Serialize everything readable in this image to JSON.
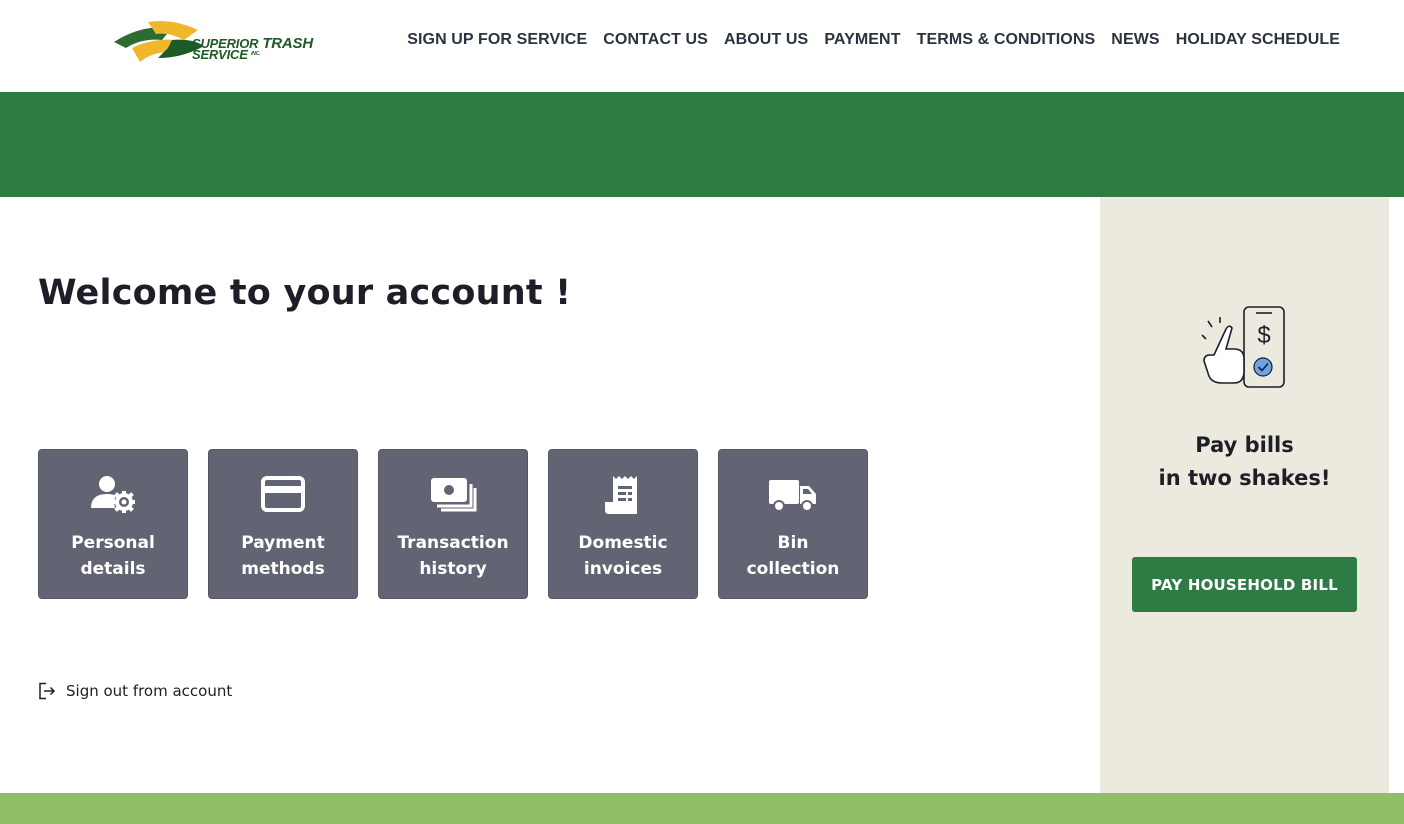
{
  "brand": {
    "logo_line1": "SUPERIOR",
    "logo_trash": "TRASH",
    "logo_line2": "SERVICE",
    "logo_suffix": "INC."
  },
  "nav": {
    "items": [
      {
        "label": "SIGN UP FOR SERVICE"
      },
      {
        "label": "CONTACT US"
      },
      {
        "label": "ABOUT US"
      },
      {
        "label": "PAYMENT"
      },
      {
        "label": "TERMS & CONDITIONS"
      },
      {
        "label": "NEWS"
      },
      {
        "label": "HOLIDAY SCHEDULE"
      }
    ]
  },
  "main": {
    "title": "Welcome to your account !",
    "tiles": [
      {
        "line1": "Personal",
        "line2": "details",
        "icon": "user-gear-icon"
      },
      {
        "line1": "Payment",
        "line2": "methods",
        "icon": "credit-card-icon"
      },
      {
        "line1": "Transaction",
        "line2": "history",
        "icon": "money-icon"
      },
      {
        "line1": "Domestic",
        "line2": "invoices",
        "icon": "receipt-icon"
      },
      {
        "line1": "Bin",
        "line2": "collection",
        "icon": "truck-icon"
      }
    ],
    "signout_label": "Sign out from account"
  },
  "sidebar": {
    "title_line1": "Pay bills",
    "title_line2": "in two shakes!",
    "button_label": "PAY HOUSEHOLD BILL"
  },
  "colors": {
    "brand_green": "#2e7b43",
    "tile_gray": "#636473",
    "sidebar_beige": "#eceadf",
    "footer_green": "#92be68",
    "logo_yellow": "#f1b72a"
  }
}
